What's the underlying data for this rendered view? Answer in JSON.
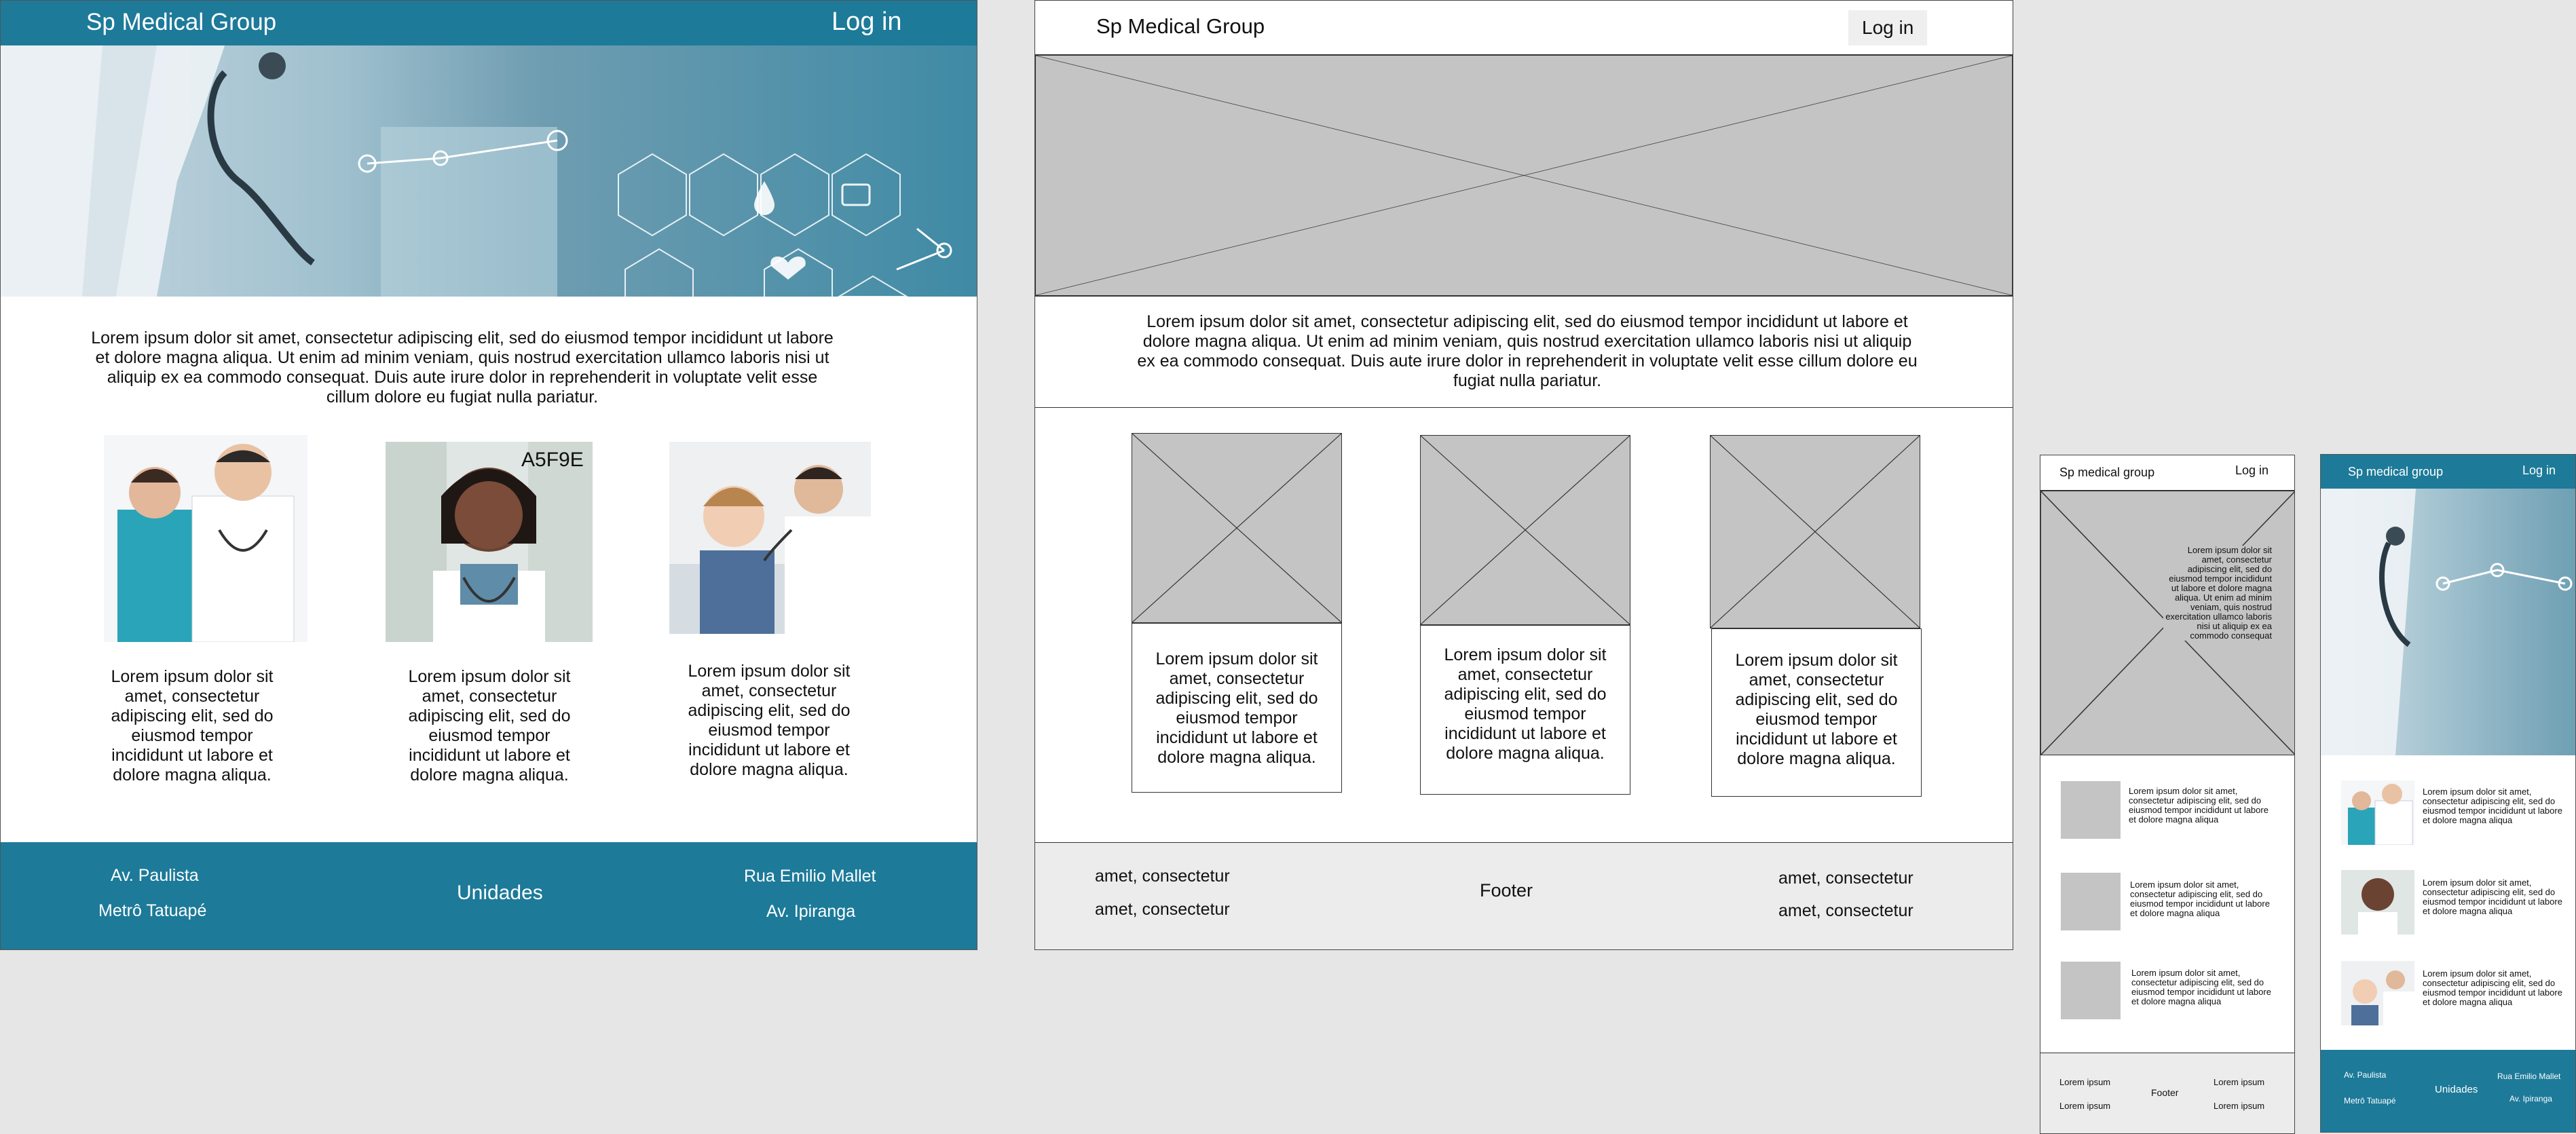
{
  "desktop_hifi": {
    "brand": "Sp Medical Group",
    "login": "Log in",
    "intro": "Lorem ipsum dolor sit amet, consectetur adipiscing elit, sed do eiusmod tempor incididunt ut labore et dolore magna aliqua. Ut enim ad minim veniam, quis nostrud exercitation ullamco laboris nisi ut aliquip ex ea commodo consequat. Duis aute irure dolor in reprehenderit in voluptate velit esse cillum dolore eu fugiat nulla pariatur.",
    "cards": [
      {
        "text": "Lorem ipsum dolor sit amet, consectetur adipiscing elit, sed do eiusmod tempor incididunt ut labore et dolore magna aliqua."
      },
      {
        "text": "Lorem ipsum dolor sit amet, consectetur adipiscing elit, sed do eiusmod tempor incididunt ut labore et dolore magna aliqua.",
        "overlay": "A5F9E"
      },
      {
        "text": "Lorem ipsum dolor sit amet, consectetur adipiscing elit, sed do eiusmod tempor incididunt ut labore et dolore magna aliqua."
      }
    ],
    "footer": {
      "left1": "Av. Paulista",
      "left2": "Metrô Tatuapé",
      "center": "Unidades",
      "right1": "Rua Emilio Mallet",
      "right2": "Av. Ipiranga"
    }
  },
  "desktop_wire": {
    "brand": "Sp Medical Group",
    "login": "Log in",
    "intro": "Lorem ipsum dolor sit amet, consectetur adipiscing elit, sed do eiusmod tempor incididunt ut labore et dolore magna aliqua. Ut enim ad minim veniam, quis nostrud exercitation ullamco laboris nisi ut aliquip ex ea commodo consequat. Duis aute irure dolor in reprehenderit in voluptate velit esse cillum dolore eu fugiat nulla pariatur.",
    "cards": [
      "Lorem ipsum dolor sit amet, consectetur adipiscing elit, sed do eiusmod tempor incididunt ut labore et dolore magna aliqua.",
      "Lorem ipsum dolor sit amet, consectetur adipiscing elit, sed do eiusmod tempor incididunt ut labore et dolore magna aliqua.",
      "Lorem ipsum dolor sit amet, consectetur adipiscing elit, sed do eiusmod tempor incididunt ut labore et dolore magna aliqua."
    ],
    "footer": {
      "left1": "amet, consectetur",
      "left2": "amet, consectetur",
      "center": "Footer",
      "right1": "amet, consectetur",
      "right2": "amet, consectetur"
    }
  },
  "mobile_wire": {
    "brand": "Sp medical group",
    "login": "Log in",
    "hero_text": "Lorem ipsum dolor sit amet, consectetur adipiscing elit, sed do eiusmod tempor incididunt ut labore et dolore magna aliqua. Ut enim ad minim veniam, quis nostrud exercitation ullamco laboris nisi ut aliquip ex ea commodo consequat",
    "items": [
      "Lorem ipsum dolor sit amet, consectetur adipiscing elit, sed do eiusmod tempor incididunt ut labore et dolore magna aliqua",
      "Lorem ipsum dolor sit amet, consectetur adipiscing elit, sed do eiusmod tempor incididunt ut labore et dolore magna aliqua",
      "Lorem ipsum dolor sit amet, consectetur adipiscing elit, sed do eiusmod tempor incididunt ut labore et dolore magna aliqua"
    ],
    "footer": {
      "left1": "Lorem ipsum",
      "left2": "Lorem ipsum",
      "center": "Footer",
      "right1": "Lorem ipsum",
      "right2": "Lorem ipsum"
    }
  },
  "mobile_hifi": {
    "brand": "Sp medical group",
    "login": "Log in",
    "items": [
      "Lorem ipsum dolor sit amet, consectetur adipiscing elit, sed do eiusmod tempor incididunt ut labore et dolore magna aliqua",
      "Lorem ipsum dolor sit amet, consectetur adipiscing elit, sed do eiusmod tempor incididunt ut labore et dolore magna aliqua",
      "Lorem ipsum dolor sit amet, consectetur adipiscing elit, sed do eiusmod tempor incididunt ut labore et dolore magna aliqua"
    ],
    "footer": {
      "left1": "Av. Paulista",
      "left2": "Metrô Tatuapé",
      "center": "Unidades",
      "right1": "Rua Emilio Mallet",
      "right2": "Av. Ipiranga"
    }
  },
  "colors": {
    "primary": "#1d7a99",
    "canvas": "#e6e6e6",
    "placeholder": "#c4c4c4"
  }
}
